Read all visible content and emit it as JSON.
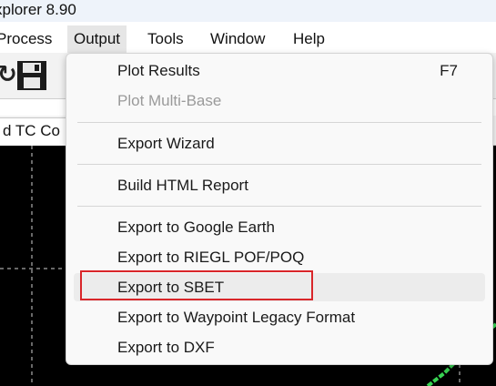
{
  "window": {
    "title": "xplorer 8.90"
  },
  "menubar": {
    "items": [
      {
        "label": "Process"
      },
      {
        "label": "Output"
      },
      {
        "label": "Tools"
      },
      {
        "label": "Window"
      },
      {
        "label": "Help"
      }
    ],
    "active": "Output"
  },
  "toolbar": {
    "icons": [
      "arrow-icon",
      "save-icon"
    ]
  },
  "document_tab": {
    "label": "d TC Co"
  },
  "dropdown": {
    "items": [
      {
        "label": "Plot Results",
        "shortcut": "F7",
        "enabled": true
      },
      {
        "label": "Plot Multi-Base",
        "enabled": false
      },
      {
        "label": "Export Wizard",
        "enabled": true
      },
      {
        "label": "Build HTML Report",
        "enabled": true
      },
      {
        "label": "Export to Google Earth",
        "enabled": true
      },
      {
        "label": "Export to RIEGL POF/POQ",
        "enabled": true
      },
      {
        "label": "Export to SBET",
        "enabled": true,
        "highlighted": true
      },
      {
        "label": "Export to Waypoint Legacy Format",
        "enabled": true
      },
      {
        "label": "Export to DXF",
        "enabled": true
      }
    ]
  },
  "colors": {
    "highlight_border": "#d9262a",
    "plot_background": "#000000",
    "plot_track": "#39d353"
  }
}
